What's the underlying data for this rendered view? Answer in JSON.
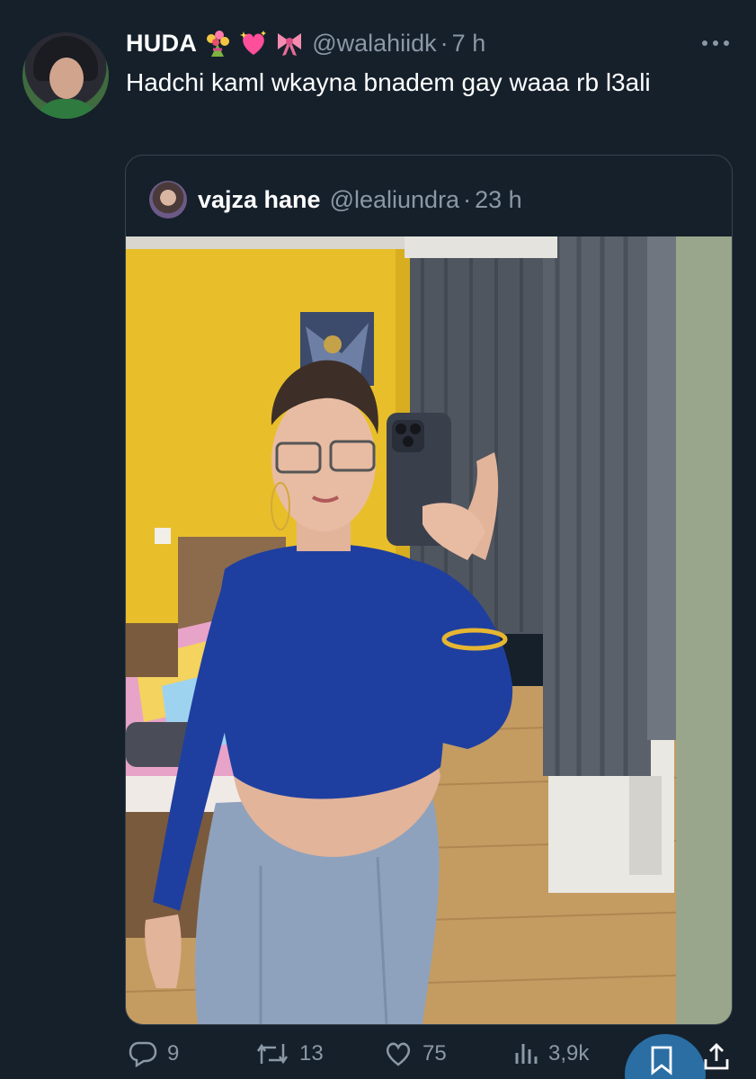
{
  "tweet": {
    "author_name": "HUDA",
    "emojis": [
      "bouquet-emoji",
      "sparkling-heart-emoji",
      "ribbon-emoji"
    ],
    "handle": "@walahiidk",
    "separator": "·",
    "time": "7 h",
    "text": "Hadchi kaml wkayna bnadem gay waaa rb l3ali"
  },
  "quoted": {
    "author_name": "vajza hane",
    "handle": "@lealiundra",
    "separator": "·",
    "time": "23 h",
    "media": "mirror-selfie-photo"
  },
  "actions": {
    "replies": "9",
    "retweets": "13",
    "likes": "75",
    "views": "3,9k"
  },
  "colors": {
    "background": "#15202b",
    "secondary_text": "#8b98a5",
    "border": "#38444d",
    "accent": "#2a6ea3"
  }
}
